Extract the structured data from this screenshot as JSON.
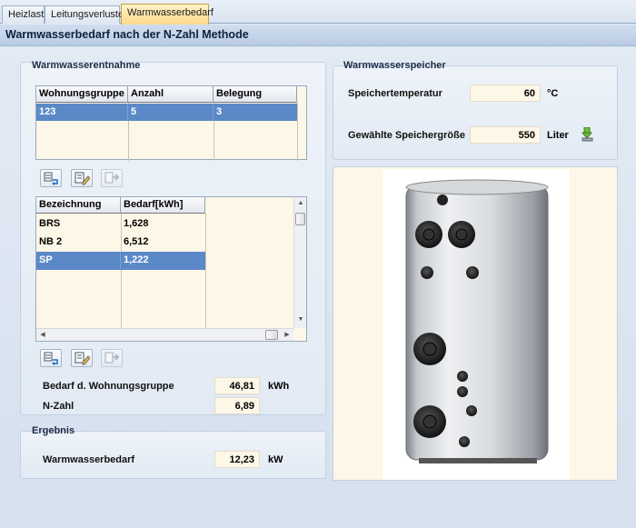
{
  "tabs": [
    {
      "label": "Heizlast"
    },
    {
      "label": "Leitungsverluste"
    },
    {
      "label": "Warmwasserbedarf",
      "active": true
    }
  ],
  "header": {
    "title": "Warmwasserbedarf nach der N-Zahl Methode"
  },
  "entnahme": {
    "title": "Warmwasserentnahme",
    "grid1": {
      "columns": [
        "Wohnungsgruppe",
        "Anzahl",
        "Belegung"
      ],
      "rows": [
        [
          "123",
          "5",
          "3"
        ]
      ]
    },
    "grid2": {
      "columns": [
        "Bezeichnung",
        "Bedarf[kWh]"
      ],
      "rows": [
        [
          "BRS",
          "1,628"
        ],
        [
          "NB 2",
          "6,512"
        ],
        [
          "SP",
          "1,222"
        ]
      ]
    },
    "bedarf_label": "Bedarf d. Wohnungsgruppe",
    "bedarf_value": "46,81",
    "bedarf_unit": "kWh",
    "nzahl_label": "N-Zahl",
    "nzahl_value": "6,89"
  },
  "ergebnis": {
    "title": "Ergebnis",
    "label": "Warmwasserbedarf",
    "value": "12,23",
    "unit": "kW"
  },
  "speicher": {
    "title": "Warmwasserspeicher",
    "temp_label": "Speichertemperatur",
    "temp_value": "60",
    "temp_unit": "°C",
    "size_label": "Gewählte Speichergröße",
    "size_value": "550",
    "size_unit": "Liter"
  },
  "icons": {
    "grid1_toolbar": [
      "add-row-icon",
      "edit-row-icon",
      "move-row-icon"
    ],
    "grid2_toolbar": [
      "add-row-icon",
      "edit-row-icon",
      "move-row-icon"
    ],
    "size_action": "download-arrow-icon"
  },
  "colors": {
    "selection": "#5b89c8",
    "grid_bg": "#fdf7e7",
    "active_tab": "#ffd98a"
  }
}
